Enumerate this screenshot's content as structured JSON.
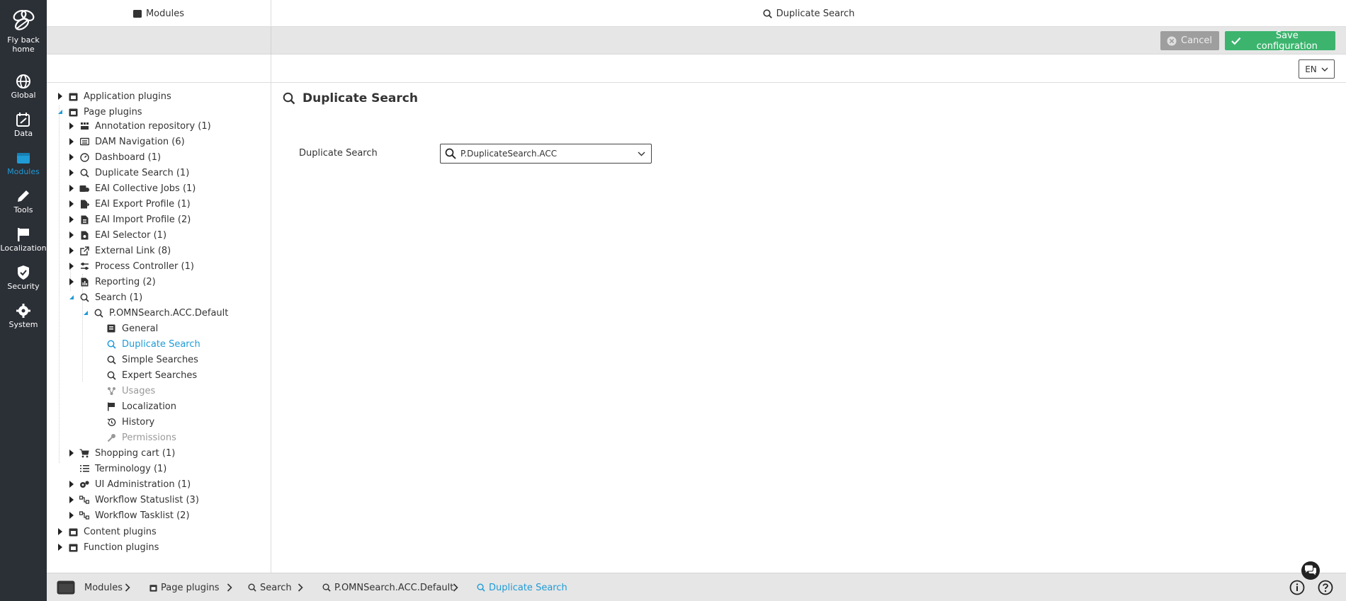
{
  "rail": {
    "home_label_1": "Fly back",
    "home_label_2": "home",
    "items": [
      {
        "label": "Global"
      },
      {
        "label": "Data"
      },
      {
        "label": "Modules"
      },
      {
        "label": "Tools"
      },
      {
        "label": "Localization"
      },
      {
        "label": "Security"
      },
      {
        "label": "System"
      }
    ],
    "active_color": "#1f9bd6"
  },
  "topbar": {
    "left_title": "Modules",
    "right_title": "Duplicate Search"
  },
  "toolbar": {
    "cancel_label": "Cancel",
    "save_label": "Save configuration",
    "save_color": "#3cb46e"
  },
  "language": {
    "selected": "EN"
  },
  "tree": {
    "roots": [
      {
        "label": "Application plugins"
      },
      {
        "label": "Page plugins"
      },
      {
        "label": "Content plugins"
      },
      {
        "label": "Function plugins"
      }
    ],
    "page_plugins": [
      {
        "label": "Annotation repository (1)",
        "icon": "annotation-icon"
      },
      {
        "label": "DAM Navigation (6)",
        "icon": "dam-icon"
      },
      {
        "label": "Dashboard (1)",
        "icon": "dashboard-icon"
      },
      {
        "label": "Duplicate Search (1)",
        "icon": "search-icon"
      },
      {
        "label": "EAI Collective Jobs (1)",
        "icon": "jobs-icon"
      },
      {
        "label": "EAI Export Profile (1)",
        "icon": "export-icon"
      },
      {
        "label": "EAI Import Profile (2)",
        "icon": "import-icon"
      },
      {
        "label": "EAI Selector (1)",
        "icon": "selector-icon"
      },
      {
        "label": "External Link (8)",
        "icon": "external-link-icon"
      },
      {
        "label": "Process Controller (1)",
        "icon": "process-icon"
      },
      {
        "label": "Reporting (2)",
        "icon": "report-icon"
      },
      {
        "label": "Search (1)",
        "icon": "search-icon"
      }
    ],
    "search_child": "P.OMNSearch.ACC.Default",
    "search_children": [
      {
        "label": "General"
      },
      {
        "label": "Duplicate Search"
      },
      {
        "label": "Simple Searches"
      },
      {
        "label": "Expert Searches"
      },
      {
        "label": "Usages"
      },
      {
        "label": "Localization"
      },
      {
        "label": "History"
      },
      {
        "label": "Permissions"
      }
    ],
    "page_plugins_after": [
      {
        "label": "Shopping cart (1)"
      },
      {
        "label": "Terminology (1)"
      },
      {
        "label": "UI Administration (1)"
      },
      {
        "label": "Workflow Statuslist (3)"
      },
      {
        "label": "Workflow Tasklist (2)"
      }
    ]
  },
  "content": {
    "title": "Duplicate Search",
    "field_label": "Duplicate Search",
    "field_value": "P.DuplicateSearch.ACC"
  },
  "breadcrumb": [
    {
      "label": "Modules"
    },
    {
      "label": "Page plugins"
    },
    {
      "label": "Search"
    },
    {
      "label": "P.OMNSearch.ACC.Default"
    },
    {
      "label": "Duplicate Search"
    }
  ]
}
